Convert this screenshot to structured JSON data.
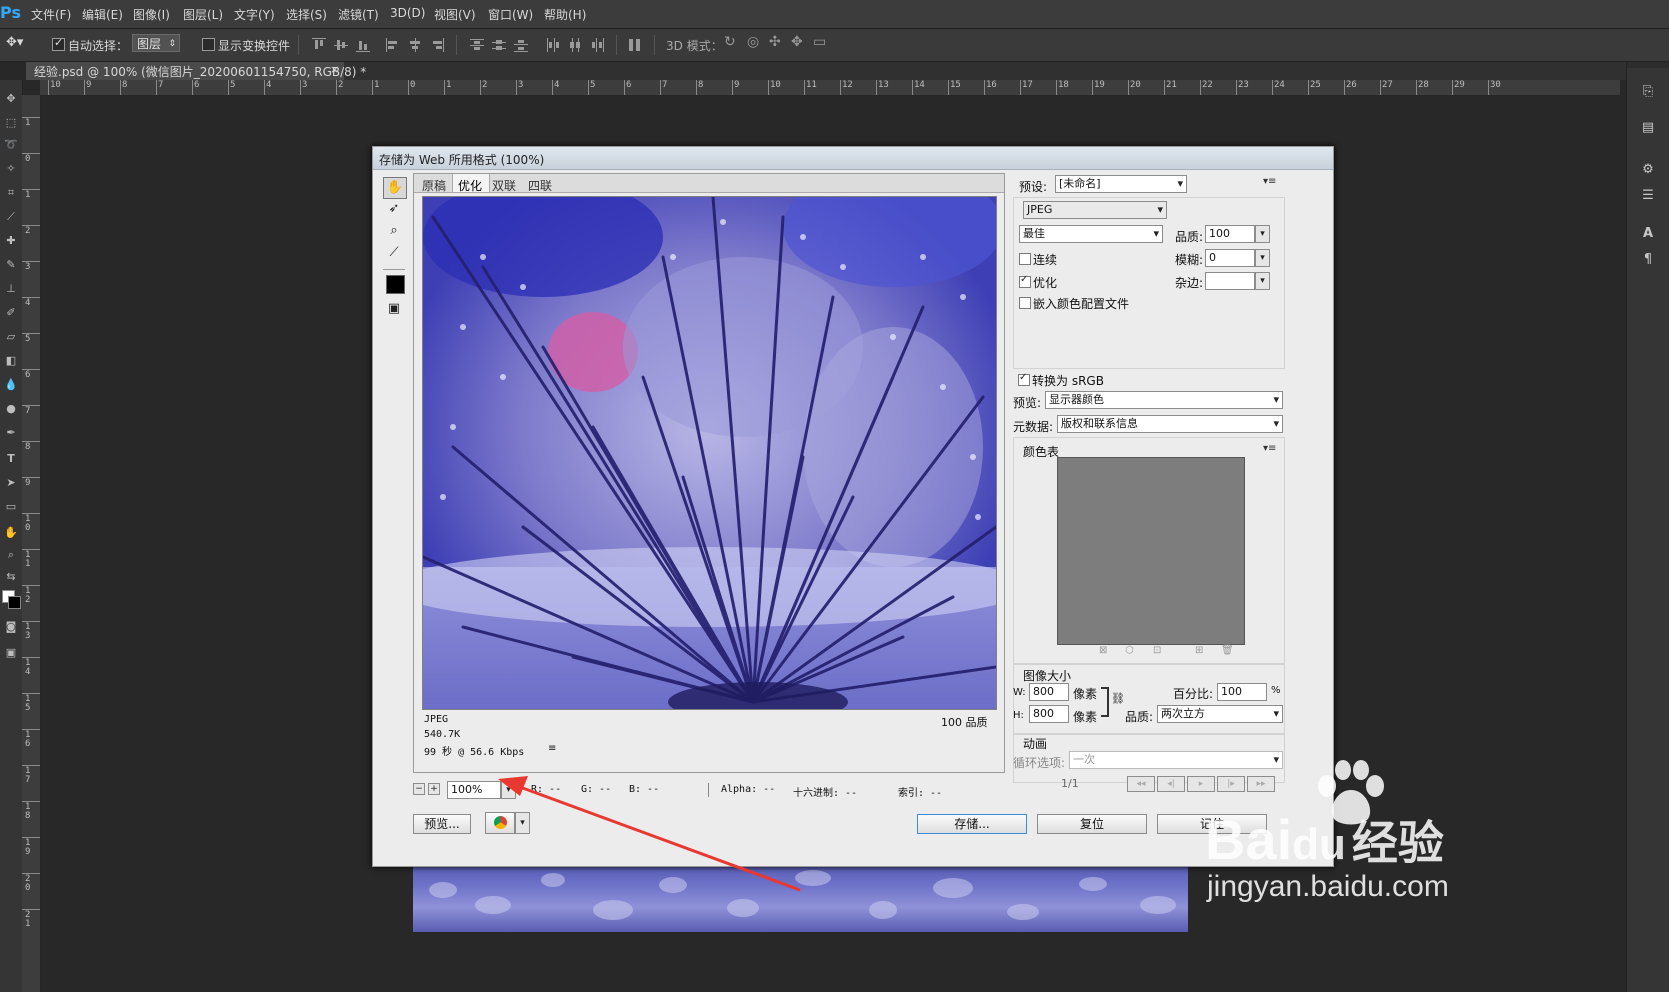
{
  "menubar": {
    "logo": "Ps",
    "items": [
      "文件(F)",
      "编辑(E)",
      "图像(I)",
      "图层(L)",
      "文字(Y)",
      "选择(S)",
      "滤镜(T)",
      "3D(D)",
      "视图(V)",
      "窗口(W)",
      "帮助(H)"
    ]
  },
  "options": {
    "auto_select_label": "自动选择：",
    "auto_select_value": "图层",
    "show_transform_label": "显示变换控件",
    "mode_3d_label": "3D 模式："
  },
  "document": {
    "tab_title": "经验.psd @ 100% (微信图片_20200601154750, RGB/8) *",
    "ruler_h": [
      "10",
      "9",
      "8",
      "7",
      "6",
      "5",
      "4",
      "3",
      "2",
      "1",
      "0",
      "1",
      "2",
      "3",
      "4",
      "5",
      "6",
      "7",
      "8",
      "9",
      "10",
      "11",
      "12",
      "13",
      "14",
      "15",
      "16",
      "17",
      "18",
      "19",
      "20",
      "21",
      "22",
      "23",
      "24",
      "25",
      "26",
      "27",
      "28",
      "29",
      "30"
    ],
    "ruler_v": [
      "1",
      "0",
      "1",
      "2",
      "3",
      "4",
      "5",
      "6",
      "7",
      "8",
      "9",
      "1 0",
      "1 1",
      "1 2",
      "1 3",
      "1 4",
      "1 5",
      "1 6",
      "1 7",
      "1 8",
      "1 9",
      "2 0",
      "2 1"
    ]
  },
  "dialog": {
    "title": "存储为 Web 所用格式 (100%)",
    "tabs": [
      "原稿",
      "优化",
      "双联",
      "四联"
    ],
    "image_info": {
      "format": "JPEG",
      "size": "540.7K",
      "time": "99 秒 @ 56.6 Kbps",
      "quality": "100 品质"
    },
    "status": {
      "zoom": "100%",
      "r": "R: --",
      "g": "G: --",
      "b": "B: --",
      "alpha": "Alpha: --",
      "hex": "十六进制: --",
      "index": "索引: --"
    },
    "settings": {
      "preset_label": "预设:",
      "preset_value": "[未命名]",
      "format_value": "JPEG",
      "quality_level": "最佳",
      "quality_label": "品质:",
      "quality_value": "100",
      "progressive": "连续",
      "blur_label": "模糊:",
      "blur_value": "0",
      "optimized": "优化",
      "matte_label": "杂边:",
      "embed_profile": "嵌入颜色配置文件",
      "convert_srgb": "转换为 sRGB",
      "preview_label": "预览:",
      "preview_value": "显示器颜色",
      "metadata_label": "元数据:",
      "metadata_value": "版权和联系信息",
      "color_table_label": "颜色表",
      "image_size_label": "图像大小",
      "w_label": "W:",
      "w_value": "800",
      "h_label": "H:",
      "h_value": "800",
      "unit": "像素",
      "percent_label": "百分比:",
      "percent_value": "100",
      "percent_unit": "%",
      "resample_label": "品质:",
      "resample_value": "两次立方",
      "animation_label": "动画",
      "loop_label": "循环选项:",
      "loop_value": "一次",
      "frame_counter": "1/1"
    },
    "buttons": {
      "preview": "预览...",
      "save": "存储...",
      "reset": "复位",
      "remember": "记住"
    }
  },
  "watermark": {
    "brand": "Bai",
    "du": "du",
    "jingyan": "经验",
    "url": "jingyan.baidu.com"
  },
  "colors": {
    "accent": "#31a8ff",
    "arrow": "#e8382f",
    "photo_tint": "#4b4fc0"
  }
}
